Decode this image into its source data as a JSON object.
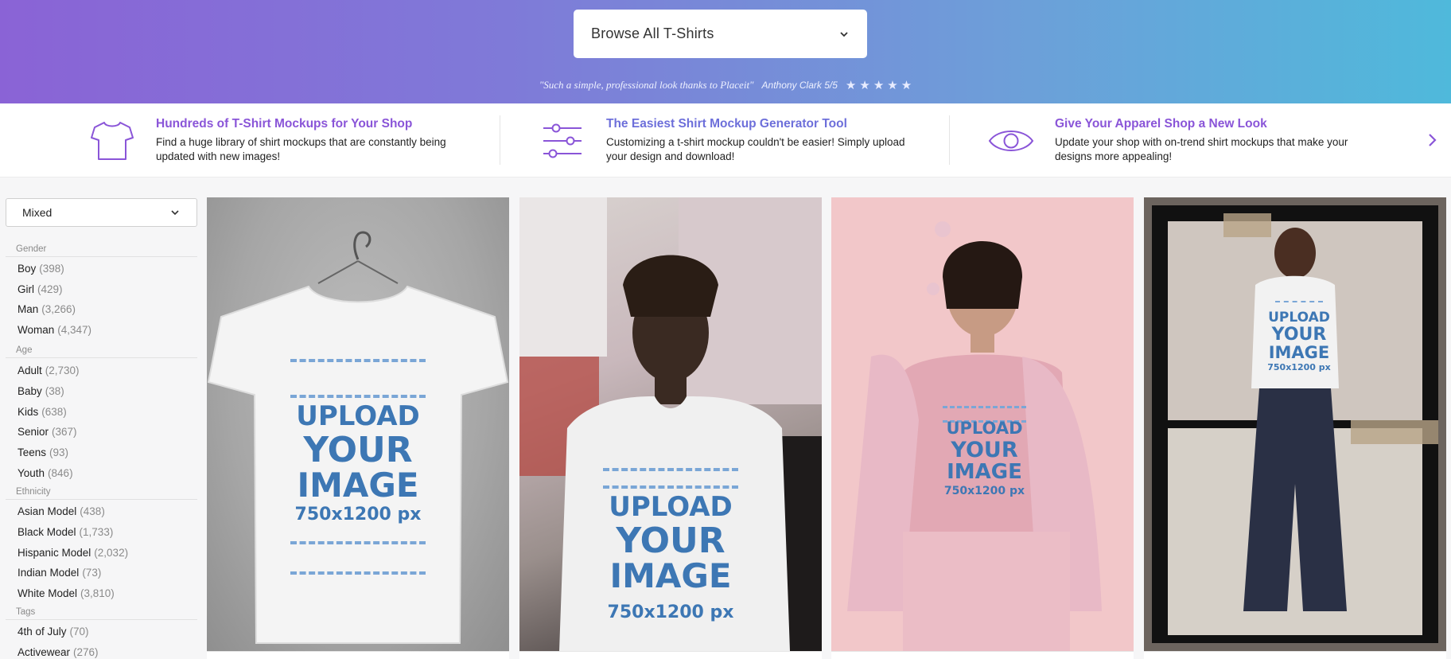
{
  "hero": {
    "browse_label": "Browse All T-Shirts",
    "review_quote": "\"Such a simple, professional look thanks to Placeit\"",
    "review_author": "Anthony Clark 5/5",
    "star_count": 5
  },
  "features": [
    {
      "title": "Hundreds of T-Shirt Mockups for Your Shop",
      "text": "Find a huge library of shirt mockups that are constantly being updated with new images!",
      "icon": "tshirt-icon"
    },
    {
      "title": "The Easiest Shirt Mockup Generator Tool",
      "text": "Customizing a t-shirt mockup couldn't be easier! Simply upload your design and download!",
      "icon": "sliders-icon"
    },
    {
      "title": "Give Your Apparel Shop a New Look",
      "text": "Update your shop with on-trend shirt mockups that make your designs more appealing!",
      "icon": "eye-icon"
    }
  ],
  "sidebar": {
    "sort_value": "Mixed",
    "groups": [
      {
        "heading": "Gender",
        "items": [
          {
            "label": "Boy",
            "count": "(398)"
          },
          {
            "label": "Girl",
            "count": "(429)"
          },
          {
            "label": "Man",
            "count": "(3,266)"
          },
          {
            "label": "Woman",
            "count": "(4,347)"
          }
        ]
      },
      {
        "heading": "Age",
        "items": [
          {
            "label": "Adult",
            "count": "(2,730)"
          },
          {
            "label": "Baby",
            "count": "(38)"
          },
          {
            "label": "Kids",
            "count": "(638)"
          },
          {
            "label": "Senior",
            "count": "(367)"
          },
          {
            "label": "Teens",
            "count": "(93)"
          },
          {
            "label": "Youth",
            "count": "(846)"
          }
        ]
      },
      {
        "heading": "Ethnicity",
        "items": [
          {
            "label": "Asian Model",
            "count": "(438)"
          },
          {
            "label": "Black Model",
            "count": "(1,733)"
          },
          {
            "label": "Hispanic Model",
            "count": "(2,032)"
          },
          {
            "label": "Indian Model",
            "count": "(73)"
          },
          {
            "label": "White Model",
            "count": "(3,810)"
          }
        ]
      },
      {
        "heading": "Tags",
        "items": [
          {
            "label": "4th of July",
            "count": "(70)"
          },
          {
            "label": "Activewear",
            "count": "(276)"
          }
        ]
      }
    ]
  },
  "mockup": {
    "line1": "UPLOAD",
    "line2": "YOUR",
    "line3": "IMAGE",
    "line4": "750x1200 px"
  },
  "colors": {
    "accent_purple": "#8a55d8",
    "accent_blue": "#6d6fda",
    "mockup_text": "#3d77b4"
  }
}
